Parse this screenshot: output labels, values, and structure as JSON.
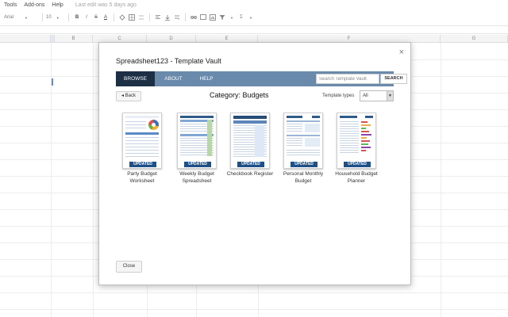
{
  "menubar": {
    "items": [
      "Tools",
      "Add-ons",
      "Help"
    ],
    "last_edit": "Last edit was 5 days ago"
  },
  "toolbar": {
    "font": "Arial",
    "font_size": "10",
    "bold": "B",
    "italic": "I",
    "strike": "S",
    "text_color": "A",
    "sum": "Σ"
  },
  "columns": [
    "B",
    "C",
    "D",
    "E",
    "F",
    "G"
  ],
  "dialog": {
    "title": "Spreadsheet123 - Template Vault",
    "close_icon": "×",
    "nav": {
      "tabs": [
        "BROWSE",
        "ABOUT",
        "HELP"
      ],
      "search_placeholder": "Search Template Vault",
      "search_button": "SEARCH"
    },
    "back_label": "◂ Back",
    "category": "Category: Budgets",
    "template_types_label": "Template types",
    "template_types_value": "All",
    "templates": [
      {
        "name": "Party Budget Worksheet",
        "badge": "UPDATED"
      },
      {
        "name": "Weekly Budget Spreadsheet",
        "badge": "UPDATED"
      },
      {
        "name": "Checkbook Register",
        "badge": "UPDATED"
      },
      {
        "name": "Personal Monthly Budget",
        "badge": "UPDATED"
      },
      {
        "name": "Household Budget Planner",
        "badge": "UPDATED"
      }
    ],
    "close_label": "Close"
  },
  "colors": {
    "nav_bar": "#6a8aab",
    "nav_active": "#1c2f45",
    "badge": "#1e4f86"
  }
}
